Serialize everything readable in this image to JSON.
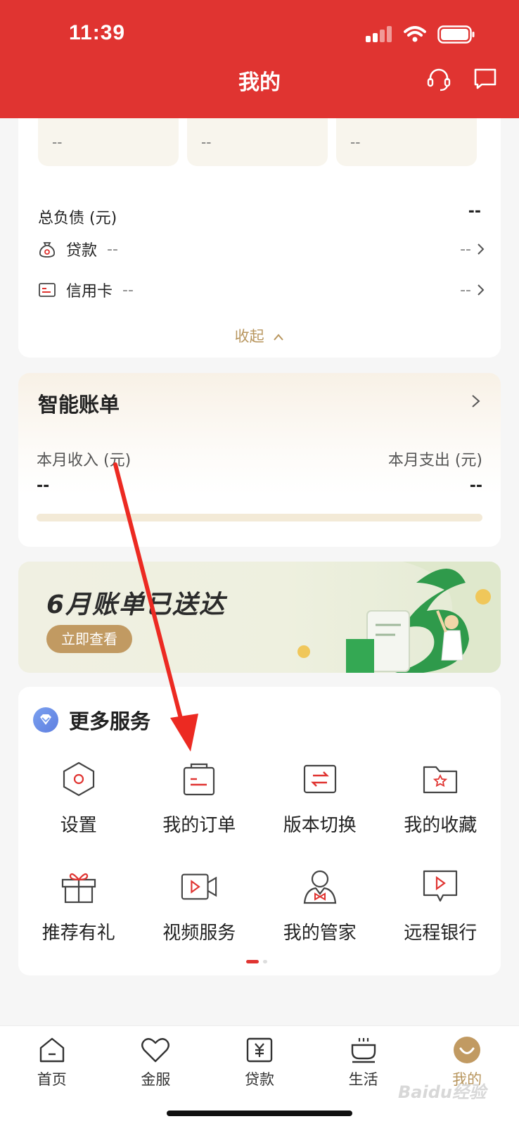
{
  "status_bar": {
    "time": "11:39"
  },
  "header": {
    "title": "我的",
    "headset_icon": "headset-icon",
    "message_icon": "message-icon"
  },
  "assets": {
    "tiles": [
      {
        "value": "--"
      },
      {
        "value": "--"
      },
      {
        "value": "--"
      }
    ]
  },
  "debt": {
    "title": "总负债 (元)",
    "total": "--",
    "rows": [
      {
        "label": "贷款",
        "value": "--",
        "right": "--",
        "icon": "loan-bag-icon"
      },
      {
        "label": "信用卡",
        "value": "--",
        "right": "--",
        "icon": "credit-card-icon"
      }
    ],
    "collapse_label": "收起"
  },
  "smart_bill": {
    "title": "智能账单",
    "income_label": "本月收入 (元)",
    "income_value": "--",
    "expense_label": "本月支出 (元)",
    "expense_value": "--"
  },
  "banner": {
    "title": "6月账单已送达",
    "button": "立即查看"
  },
  "services": {
    "title": "更多服务",
    "items": [
      {
        "label": "设置",
        "icon": "settings-hexagon-icon"
      },
      {
        "label": "我的订单",
        "icon": "order-icon"
      },
      {
        "label": "版本切换",
        "icon": "switch-icon"
      },
      {
        "label": "我的收藏",
        "icon": "favorites-folder-icon"
      },
      {
        "label": "推荐有礼",
        "icon": "gift-icon"
      },
      {
        "label": "视频服务",
        "icon": "video-camera-icon"
      },
      {
        "label": "我的管家",
        "icon": "butler-icon"
      },
      {
        "label": "远程银行",
        "icon": "remote-bank-icon"
      }
    ],
    "page_indicator": {
      "pages": 2,
      "current": 1
    }
  },
  "tabbar": {
    "tabs": [
      {
        "label": "首页",
        "icon": "home-icon",
        "active": false
      },
      {
        "label": "金服",
        "icon": "heart-icon",
        "active": false
      },
      {
        "label": "贷款",
        "icon": "yuan-loan-icon",
        "active": false
      },
      {
        "label": "生活",
        "icon": "coffee-cup-icon",
        "active": false
      },
      {
        "label": "我的",
        "icon": "profile-smile-icon",
        "active": true
      }
    ]
  },
  "watermark": "Baidu经验",
  "colors": {
    "brand_red": "#e03431",
    "gold": "#b8965e",
    "annotation_red": "#ec2a22"
  }
}
